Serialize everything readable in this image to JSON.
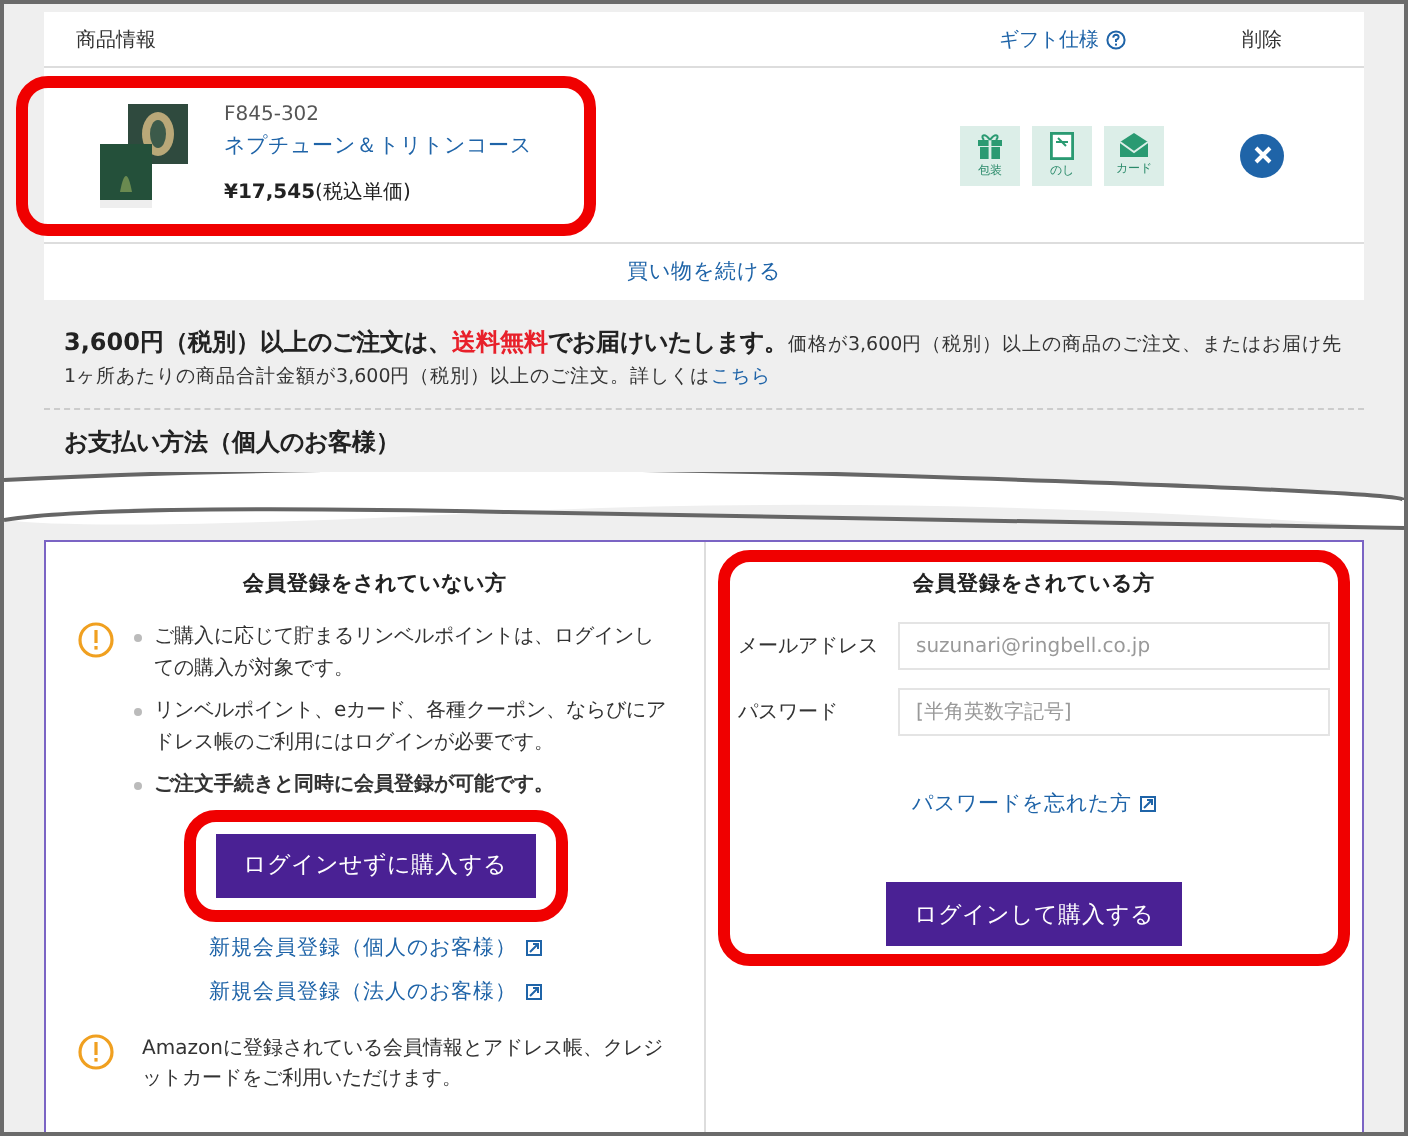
{
  "cart": {
    "columns": [
      {
        "label": "商品情報",
        "kind": "plain"
      },
      {
        "label": "ギフト仕様",
        "kind": "help"
      },
      {
        "label": "削除",
        "kind": "plain"
      }
    ],
    "item": {
      "code": "F845-302",
      "name": "ネプチューン＆トリトンコース",
      "price": "¥17,545",
      "price_note": "(税込単価)",
      "gift_options": [
        {
          "label": "包装",
          "kind": "wrap"
        },
        {
          "label": "のし",
          "kind": "noshi"
        },
        {
          "label": "カード",
          "kind": "card"
        }
      ]
    },
    "continue_link": "買い物を続ける"
  },
  "shipping_notice": [
    {
      "text": "3,600円（税別）以上のご注文は、",
      "kind": "bold"
    },
    {
      "text": "送料無料",
      "kind": "highlight"
    },
    {
      "text": "でお届けいたします。",
      "kind": "bold"
    },
    {
      "text": "価格が3,600円（税別）以上の商品のご注文、またはお届け先1ヶ所あたりの商品合計金額が3,600円（税別）以上のご注文。詳しくは",
      "kind": "plain"
    },
    {
      "text": "こちら",
      "kind": "link"
    }
  ],
  "payment_heading": "お支払い方法（個人のお客様）",
  "guest": {
    "title": "会員登録をされていない方",
    "notes": [
      {
        "text": "ご購入に応じて貯まるリンベルポイントは、ログインしての購入が対象です。",
        "bold": false
      },
      {
        "text": "リンベルポイント、eカード、各種クーポン、ならびにアドレス帳のご利用にはログインが必要です。",
        "bold": false
      },
      {
        "text": "ご注文手続きと同時に会員登録が可能です。",
        "bold": true
      }
    ],
    "button": "ログインせずに購入する",
    "links": [
      "新規会員登録（個人のお客様）",
      "新規会員登録（法人のお客様）"
    ],
    "amazon_note": "Amazonに登録されている会員情報とアドレス帳、クレジットカードをご利用いただけます。"
  },
  "member": {
    "title": "会員登録をされている方",
    "fields": [
      {
        "label": "メールアドレス",
        "placeholder": "suzunari@ringbell.co.jp"
      },
      {
        "label": "パスワード",
        "placeholder": "[半角英数字記号]"
      }
    ],
    "forgot_link": "パスワードを忘れた方",
    "button": "ログインして購入する"
  }
}
